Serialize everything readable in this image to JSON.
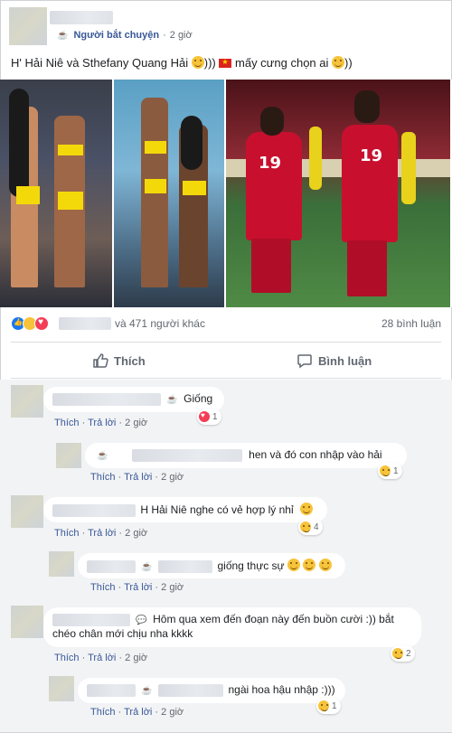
{
  "post": {
    "group_name": "Người bắt chuyện",
    "time": "2 giờ",
    "text_part1": "H' Hải Niê và Sthefany Quang Hải",
    "text_part2": ")))",
    "text_part3": "mấy cưng chọn ai",
    "text_part4": "))",
    "reactions_others": "và 471 người khác",
    "comment_count": "28 bình luận",
    "like_label": "Thích",
    "comment_label": "Bình luận",
    "jersey_left": "19",
    "jersey_right": "19"
  },
  "comment_meta": {
    "like": "Thích",
    "reply": "Trả lời",
    "time": "2 giờ",
    "sep": "·"
  },
  "comments": [
    {
      "text": "Giống",
      "reaction_count": "1",
      "reaction": "love"
    },
    {
      "text": "hen và đó con nhập vào hải",
      "reaction_count": "1",
      "reaction": "haha"
    },
    {
      "text": "H Hải Niê nghe có vẻ hợp lý nhỉ",
      "reaction_count": "4",
      "reaction": "haha"
    },
    {
      "text": "giống thực sự",
      "reaction_count": "",
      "reaction": ""
    },
    {
      "text": "Hôm qua xem đến đoạn này đến buồn cười :)) bắt chéo chân mới chịu nha kkkk",
      "reaction_count": "2",
      "reaction": "haha"
    },
    {
      "text": "ngài hoa hậu nhập :)))",
      "reaction_count": "1",
      "reaction": "haha"
    }
  ],
  "colors": {
    "link": "#385898",
    "bubble_bg": "#ffffff",
    "comments_bg": "#f2f3f5",
    "like_blue": "#1877f2"
  }
}
